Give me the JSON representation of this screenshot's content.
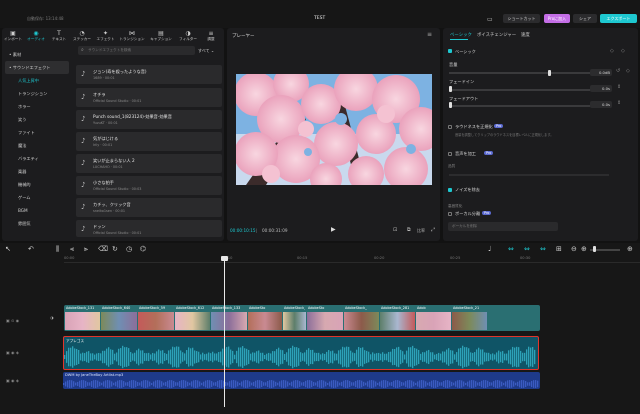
{
  "topbar": {
    "autosave": "自動保存: 13:14:48",
    "project_title": "TEST",
    "shortcut": "ショートカット",
    "pro": "Proに加入",
    "share": "シェア",
    "export": "エクスポート"
  },
  "toolbar": {
    "items": [
      {
        "label": "インポート",
        "icon": "import-icon"
      },
      {
        "label": "オーディオ",
        "icon": "audio-icon"
      },
      {
        "label": "テキスト",
        "icon": "text-icon"
      },
      {
        "label": "ステッカー",
        "icon": "sticker-icon"
      },
      {
        "label": "エフェクト",
        "icon": "effect-icon"
      },
      {
        "label": "トランジション",
        "icon": "transition-icon"
      },
      {
        "label": "キャプション",
        "icon": "caption-icon"
      },
      {
        "label": "フィルター",
        "icon": "filter-icon"
      },
      {
        "label": "調整",
        "icon": "adjust-icon"
      }
    ]
  },
  "sidebar": {
    "favorites": "• 素材",
    "sound_effects": "• サウンドエフェクト",
    "categories": [
      "人気上昇中",
      "トランジション",
      "ホラー",
      "笑う",
      "ファイト",
      "魔法",
      "バラエティ",
      "楽器",
      "機械的",
      "ゲーム",
      "BGM",
      "雰囲気"
    ]
  },
  "search": {
    "placeholder": "サウンドエフェクトを検索",
    "filter": "すべて"
  },
  "sounds": [
    {
      "title": "ジョン(寿を殺ったような音)",
      "sub": "1689 · 00:01"
    },
    {
      "title": "オチラ",
      "sub": "Official Sound Studio · 00:01"
    },
    {
      "title": "Punch sound_1(823124)-効果音-効果音",
      "sub": "YuzuKT · 00:01"
    },
    {
      "title": "気がはじける",
      "sub": "Irily · 00:01"
    },
    {
      "title": "笑いが止まらない人 2",
      "sub": "LUCHAHO · 00:01"
    },
    {
      "title": "小さな拍手",
      "sub": "Official Sound Studio · 00:03"
    },
    {
      "title": "カチッ、クリック音",
      "sub": "sneiko1sen · 00:01"
    },
    {
      "title": "ドッン",
      "sub": "Official Sound Studio · 00:01"
    }
  ],
  "player": {
    "label": "プレーヤー",
    "current": "00:00:10:15",
    "total": "00:00:31:09",
    "ratio": "比率"
  },
  "props": {
    "tabs": [
      "ベーシック",
      "ボイスチェンジャー",
      "速度"
    ],
    "basic": "ベーシック",
    "volume": "音量",
    "volume_val": "0.0dB",
    "fadein": "フェードイン",
    "fadein_val": "0.0s",
    "fadeout": "フェードアウト",
    "fadeout_val": "0.0s",
    "loudness": "ラウドネスを正規化",
    "loudness_desc": "音量を調整してクリップのラウドネスを目標レベルに正規化します。",
    "enhance": "音声を加工",
    "quality": "品質",
    "noise": "ノイズを除去",
    "noise_sub": "高音質化",
    "vocal": "ボーカル分離",
    "vocal_sub": "ボーカルを削除",
    "badge": "Pro"
  },
  "timeline": {
    "ticks": [
      "00:00",
      "00:10",
      "00:15",
      "00:20",
      "00:25",
      "00:30"
    ],
    "video_clips": [
      "AdobeStock_131",
      "AdobeStock_640",
      "AdobeStock_59",
      "AdobeStock_612",
      "AdobeStock_133",
      "AdobeSto",
      "AdobeStock_1",
      "AdobeSto",
      "AdobeStock_",
      "AdobeStock_281",
      "Adob",
      "AdobeStock_21"
    ],
    "audio_clip": "アプレゴス",
    "bgm_clip": "DWM by JaneTheBoy Artlist.mp3"
  },
  "colors": {
    "accent": "#1ec8d0",
    "pro": "#c46ee6",
    "selection": "#e0352b"
  }
}
